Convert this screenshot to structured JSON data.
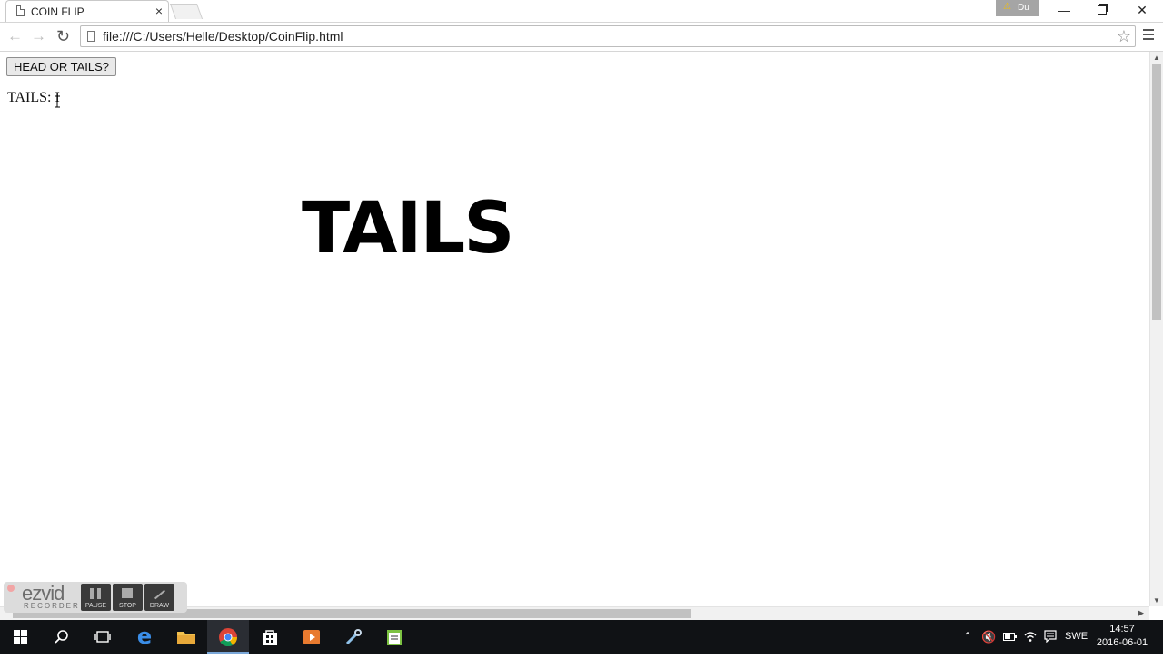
{
  "browser": {
    "tab_title": "COIN FLIP",
    "tab_close": "×",
    "profile_name": "Du",
    "url": "file:///C:/Users/Helle/Desktop/CoinFlip.html"
  },
  "page": {
    "button_label": "HEAD OR TAILS?",
    "result_label": "TAILS:",
    "result_value": "I",
    "big_result": "TAILS"
  },
  "ezvid": {
    "logo": "ezvid",
    "subtitle": "RECORDER",
    "pause_label": "PAUSE",
    "stop_label": "STOP",
    "draw_label": "DRAW"
  },
  "taskbar": {
    "language": "SWE",
    "time": "14:57",
    "date": "2016-06-01"
  }
}
